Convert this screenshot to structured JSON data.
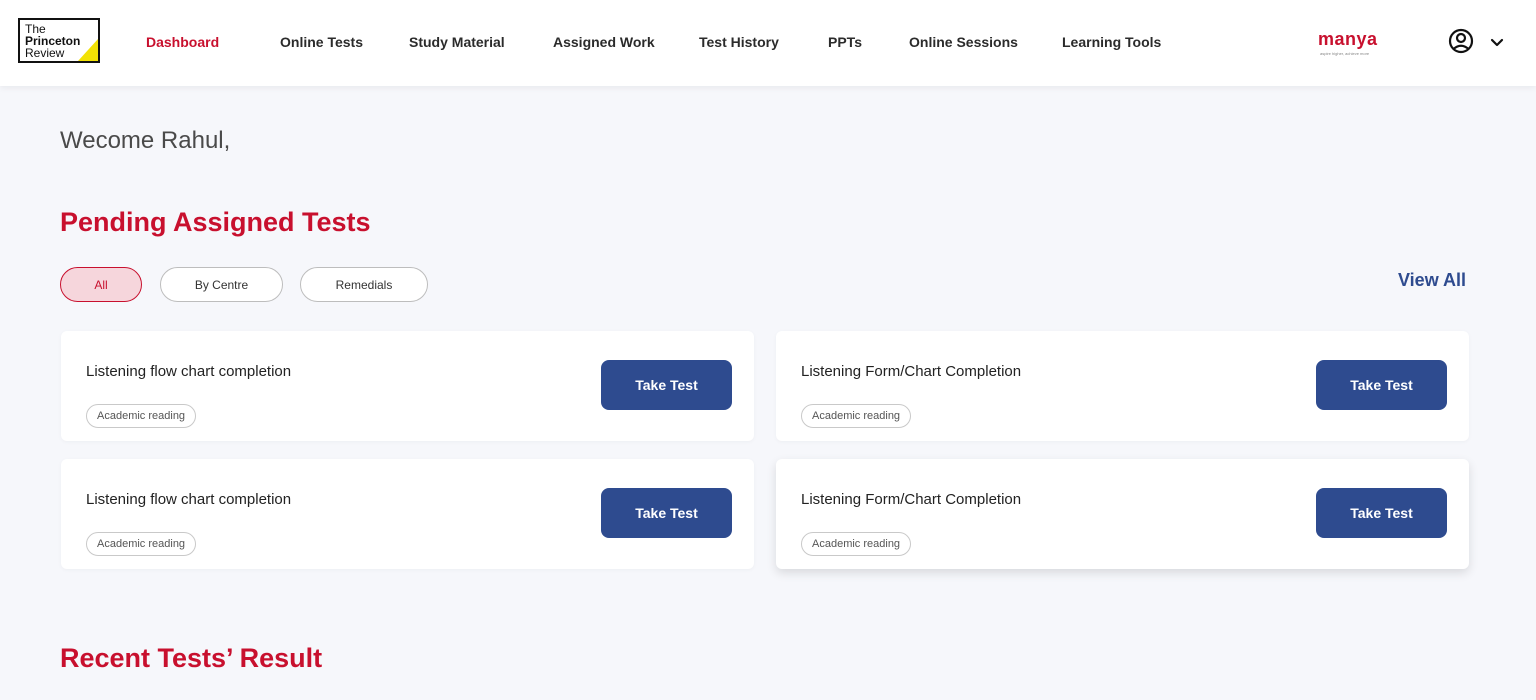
{
  "header": {
    "logo": {
      "line1": "The",
      "line2": "Princeton",
      "line3": "Review"
    },
    "nav": [
      {
        "label": "Dashboard",
        "active": true
      },
      {
        "label": "Online Tests"
      },
      {
        "label": "Study Material"
      },
      {
        "label": "Assigned Work"
      },
      {
        "label": "Test History"
      },
      {
        "label": "PPTs"
      },
      {
        "label": "Online Sessions"
      },
      {
        "label": "Learning Tools"
      }
    ],
    "partner_logo": {
      "name": "manya",
      "tagline": "aspire higher, achieve more"
    },
    "account_icon": "user-circle-icon",
    "dropdown_icon": "chevron-down-icon"
  },
  "main": {
    "welcome": "Wecome Rahul,",
    "pending_title": "Pending Assigned Tests",
    "filters": [
      {
        "label": "All",
        "active": true
      },
      {
        "label": "By Centre"
      },
      {
        "label": "Remedials"
      }
    ],
    "view_all": "View All",
    "cards": [
      {
        "title": "Listening flow chart completion",
        "tag": "Academic reading",
        "button": "Take Test"
      },
      {
        "title": "Listening Form/Chart Completion",
        "tag": "Academic reading",
        "button": "Take Test"
      },
      {
        "title": "Listening flow chart completion",
        "tag": "Academic reading",
        "button": "Take Test"
      },
      {
        "title": "Listening Form/Chart Completion",
        "tag": "Academic reading",
        "button": "Take Test"
      }
    ],
    "recent_title": "Recent Tests’ Result"
  },
  "colors": {
    "brand_red": "#c8102e",
    "primary_blue": "#2e4b8f",
    "active_filter_bg": "#f6d6dc",
    "page_bg": "#f6f7fb"
  }
}
